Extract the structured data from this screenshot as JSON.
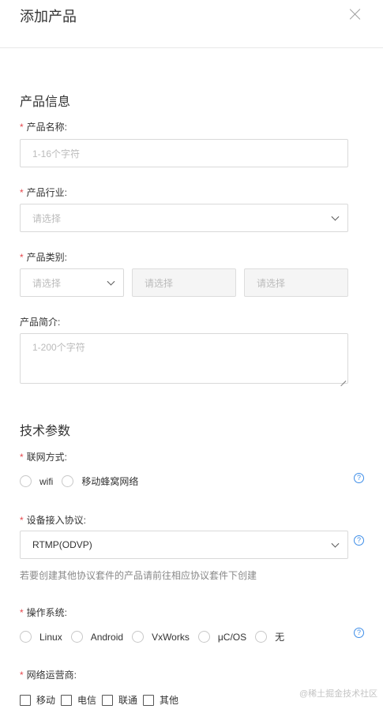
{
  "dialog": {
    "title": "添加产品"
  },
  "product_info": {
    "section_title": "产品信息",
    "name": {
      "label": "产品名称:",
      "placeholder": "1-16个字符"
    },
    "industry": {
      "label": "产品行业:",
      "placeholder": "请选择"
    },
    "category": {
      "label": "产品类别:",
      "placeholders": [
        "请选择",
        "请选择",
        "请选择"
      ]
    },
    "description": {
      "label": "产品简介:",
      "placeholder": "1-200个字符"
    }
  },
  "tech_params": {
    "section_title": "技术参数",
    "network": {
      "label": "联网方式:",
      "options": [
        "wifi",
        "移动蜂窝网络"
      ]
    },
    "protocol": {
      "label": "设备接入协议:",
      "value": "RTMP(ODVP)",
      "hint": "若要创建其他协议套件的产品请前往相应协议套件下创建"
    },
    "os": {
      "label": "操作系统:",
      "options": [
        "Linux",
        "Android",
        "VxWorks",
        "μC/OS",
        "无"
      ]
    },
    "carrier": {
      "label": "网络运营商:",
      "options": [
        "移动",
        "电信",
        "联通",
        "其他"
      ]
    }
  },
  "help_icon_glyph": "?",
  "required_mark": "*",
  "watermark": "@稀土掘金技术社区"
}
